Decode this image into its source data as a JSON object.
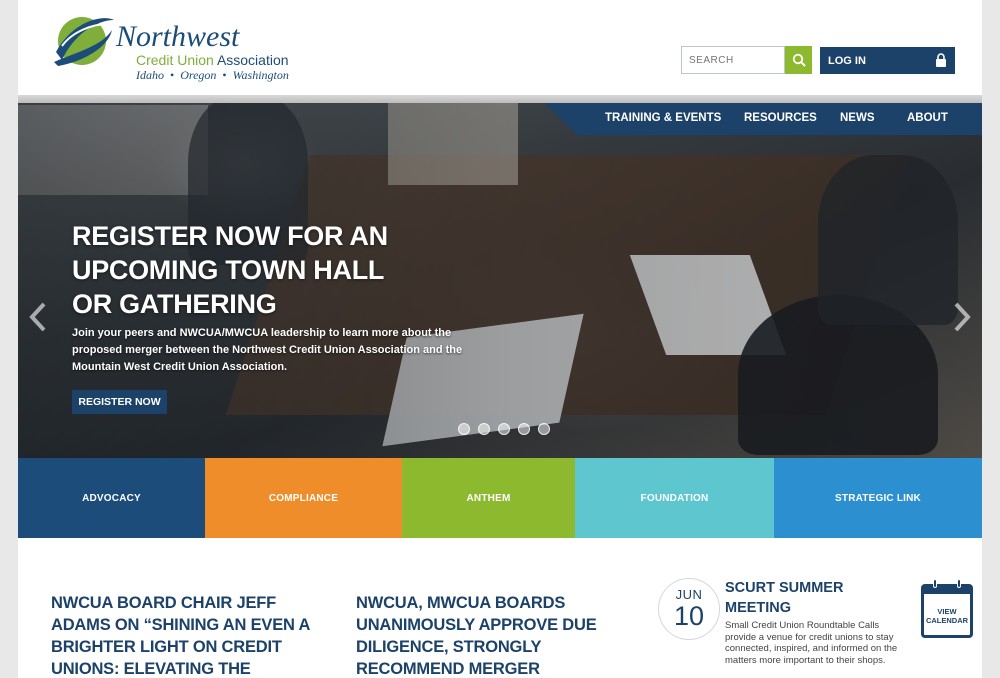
{
  "header": {
    "logo": {
      "name": "Northwest",
      "sub_part1": "Credit Union ",
      "sub_part2": "Association",
      "states": [
        "Idaho",
        "Oregon",
        "Washington"
      ]
    },
    "search_placeholder": "SEARCH",
    "login_label": "LOG IN"
  },
  "nav": {
    "items": [
      "TRAINING & EVENTS",
      "RESOURCES",
      "NEWS",
      "ABOUT"
    ]
  },
  "hero": {
    "title": "REGISTER NOW FOR AN UPCOMING TOWN HALL OR GATHERING",
    "text": "Join your peers and NWCUA/MWCUA leadership to learn more about the proposed merger between the Northwest Credit Union Association and the Mountain West Credit Union Association.",
    "cta": "REGISTER NOW",
    "slide_count": 5
  },
  "tiles": [
    {
      "label": "ADVOCACY",
      "color": "#1c4c7a"
    },
    {
      "label": "COMPLIANCE",
      "color": "#ef8d2a"
    },
    {
      "label": "ANTHEM",
      "color": "#8db92e"
    },
    {
      "label": "FOUNDATION",
      "color": "#5ec6cf"
    },
    {
      "label": "STRATEGIC LINK",
      "color": "#2b8fd0"
    }
  ],
  "news": [
    {
      "title": "NWCUA BOARD CHAIR JEFF ADAMS ON “SHINING AN EVEN A BRIGHTER LIGHT ON CREDIT UNIONS: ELEVATING THE ASSOCIATION MODEL”"
    },
    {
      "title": "NWCUA, MWCUA BOARDS UNANIMOUSLY APPROVE DUE DILIGENCE, STRONGLY RECOMMEND MERGER"
    }
  ],
  "event": {
    "month": "JUN",
    "day": "10",
    "title": "SCURT SUMMER MEETING",
    "description": "Small Credit Union Roundtable Calls provide a venue for credit unions to stay connected, inspired, and informed on the matters more important to their shops."
  },
  "calendar_button": {
    "line1": "VIEW",
    "line2": "CALENDAR"
  },
  "colors": {
    "navy": "#1c4269",
    "green": "#8db92e"
  }
}
